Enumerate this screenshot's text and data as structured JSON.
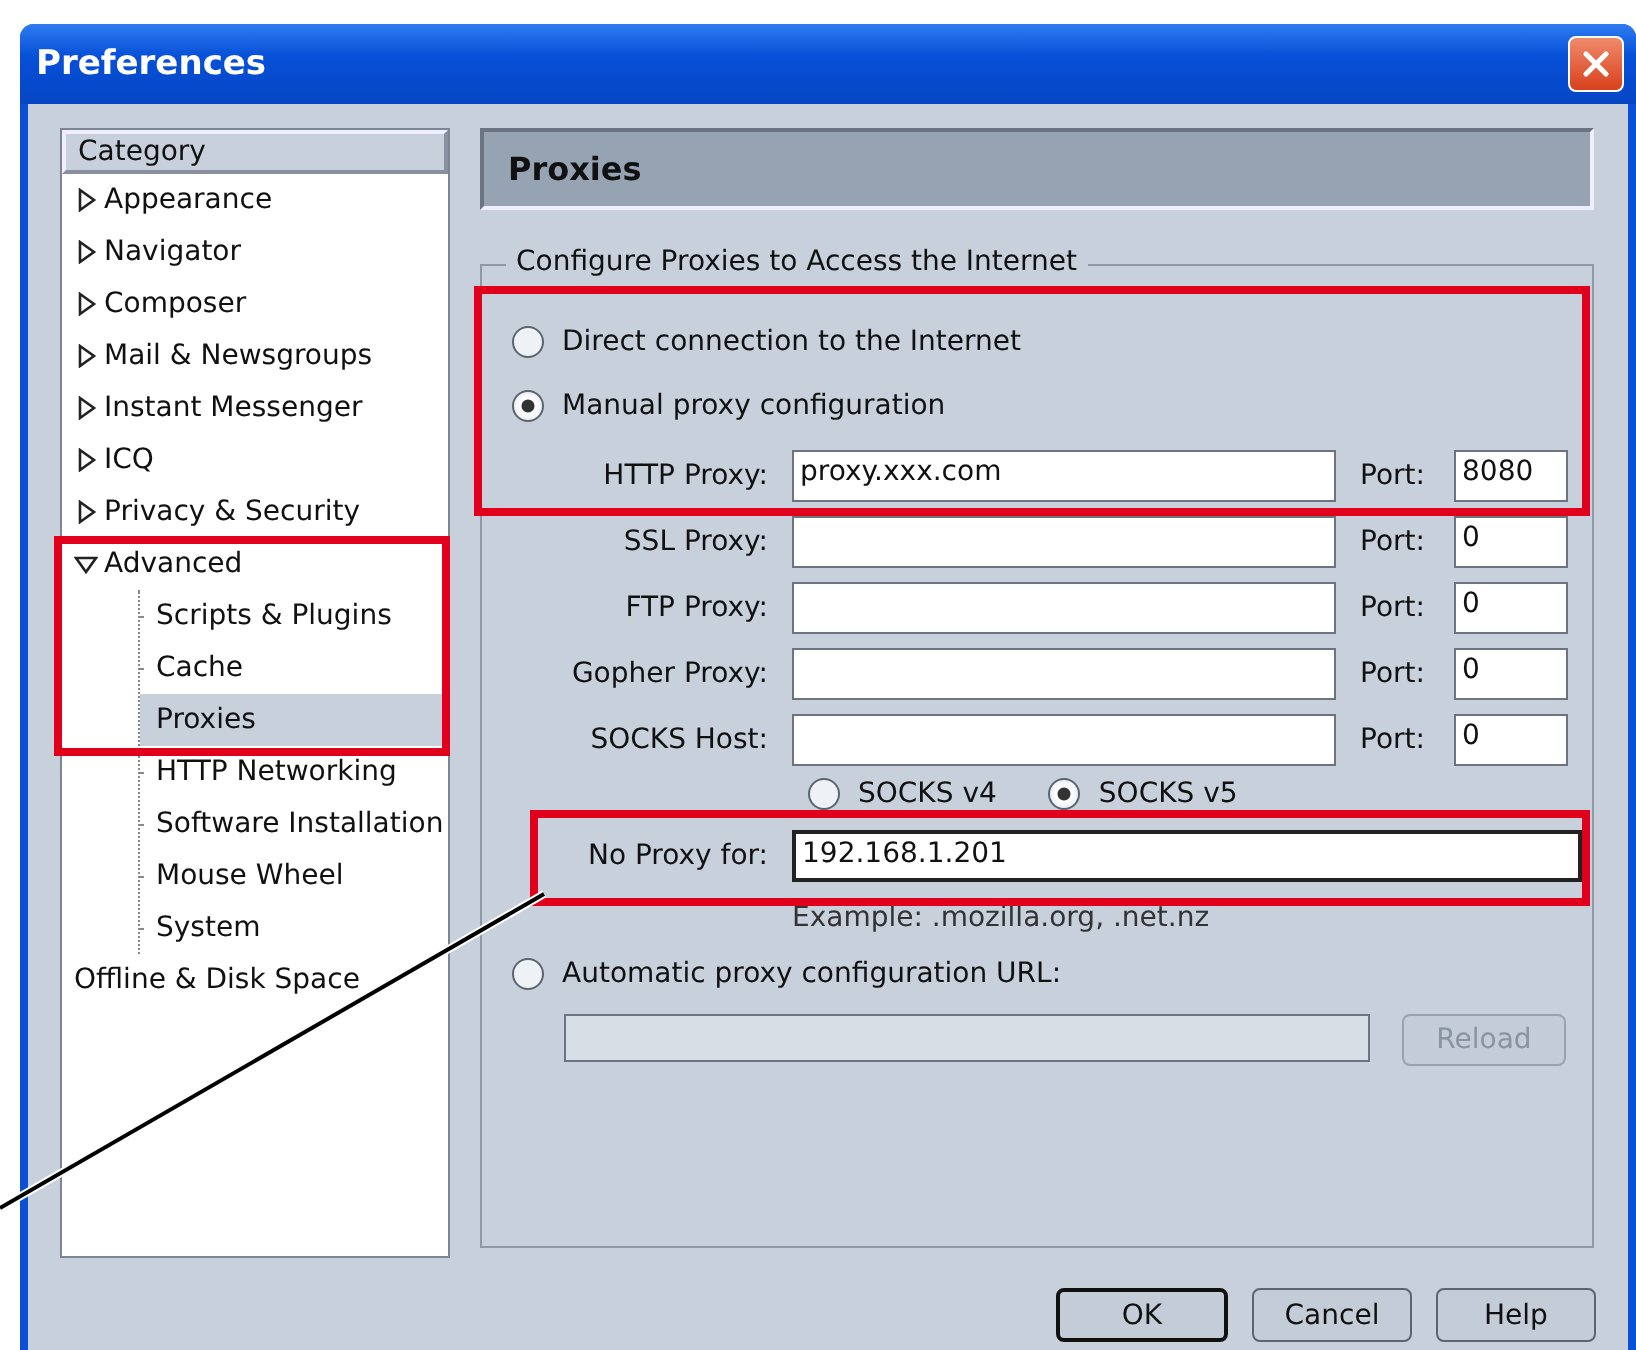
{
  "window": {
    "title": "Preferences"
  },
  "sidebar": {
    "header": "Category",
    "items": [
      {
        "label": "Appearance",
        "expanded": false,
        "selected": false
      },
      {
        "label": "Navigator",
        "expanded": false,
        "selected": false
      },
      {
        "label": "Composer",
        "expanded": false,
        "selected": false
      },
      {
        "label": "Mail & Newsgroups",
        "expanded": false,
        "selected": false
      },
      {
        "label": "Instant Messenger",
        "expanded": false,
        "selected": false
      },
      {
        "label": "ICQ",
        "expanded": false,
        "selected": false
      },
      {
        "label": "Privacy & Security",
        "expanded": false,
        "selected": false
      },
      {
        "label": "Advanced",
        "expanded": true,
        "selected": false,
        "children": [
          {
            "label": "Scripts & Plugins",
            "selected": false
          },
          {
            "label": "Cache",
            "selected": false
          },
          {
            "label": "Proxies",
            "selected": true
          },
          {
            "label": "HTTP Networking",
            "selected": false
          },
          {
            "label": "Software Installation",
            "selected": false
          },
          {
            "label": "Mouse Wheel",
            "selected": false
          },
          {
            "label": "System",
            "selected": false
          }
        ]
      },
      {
        "label": "Offline & Disk Space",
        "selected": false
      }
    ]
  },
  "panel": {
    "title": "Proxies",
    "group_title": "Configure Proxies to Access the Internet",
    "modes": [
      {
        "label": "Direct connection to the Internet",
        "selected": false
      },
      {
        "label": "Manual proxy configuration",
        "selected": true
      }
    ],
    "proxies": [
      {
        "label": "HTTP Proxy:",
        "value": "proxy.xxx.com",
        "port_label": "Port:",
        "port": "8080"
      },
      {
        "label": "SSL Proxy:",
        "port_label": "Port:",
        "port": "0"
      },
      {
        "label": "FTP Proxy:",
        "port_label": "Port:",
        "port": "0"
      },
      {
        "label": "Gopher Proxy:",
        "port_label": "Port:",
        "port": "0"
      },
      {
        "label": "SOCKS Host:",
        "port_label": "Port:",
        "port": "0"
      }
    ],
    "socks_versions": [
      {
        "label": "SOCKS v4",
        "selected": false
      },
      {
        "label": "SOCKS v5",
        "selected": true
      }
    ],
    "no_proxy": {
      "label": "No Proxy for:",
      "value": "192.168.1.201"
    },
    "example": "Example: .mozilla.org, .net.nz",
    "automatic": {
      "label": "Automatic proxy configuration URL:",
      "selected": false
    },
    "url_field": {
      "disabled": true
    },
    "reload": {
      "label": "Reload",
      "disabled": true
    }
  },
  "buttons": [
    {
      "label": "OK",
      "default": true
    },
    {
      "label": "Cancel",
      "default": false
    },
    {
      "label": "Help",
      "default": false
    }
  ]
}
